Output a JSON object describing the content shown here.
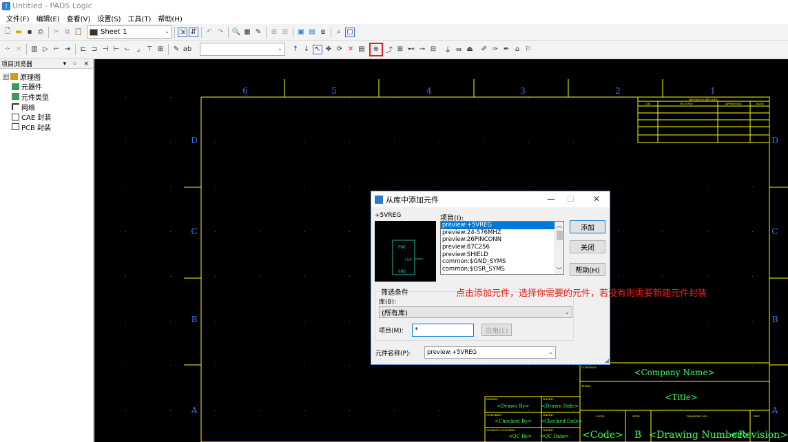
{
  "window": {
    "title": "Untitled - PADS Logic"
  },
  "menu": [
    "文件(F)",
    "编辑(E)",
    "查看(V)",
    "设置(S)",
    "工具(T)",
    "帮助(H)"
  ],
  "toolbar": {
    "sheet_select": "Sheet 1",
    "mode_select": ""
  },
  "browser": {
    "title": "项目浏览器",
    "controls": "▾ ⁘ ×",
    "items": [
      {
        "label": "原理图",
        "expander": "⊞"
      },
      {
        "label": "元器件"
      },
      {
        "label": "元件类型"
      },
      {
        "label": "网络"
      },
      {
        "label": "CAE 封装"
      },
      {
        "label": "PCB 封装"
      }
    ]
  },
  "sheet": {
    "columns": [
      "6",
      "5",
      "4",
      "3",
      "2",
      "1"
    ],
    "rows": [
      "D",
      "C",
      "B",
      "A"
    ],
    "revision_record": {
      "title": "REVISION RECORD",
      "headers": [
        "LTR",
        "ECO NO:",
        "APPROVED:",
        "DATE:"
      ]
    },
    "title_block": {
      "company_label": "COMPANY:",
      "company_value": "<Company Name>",
      "title_label": "TITLE:",
      "title_value": "<Title>",
      "code_label": "CODE:",
      "code_value": "<Code>",
      "size_label": "SIZE:",
      "size_value": "B",
      "drawing_no_label": "DRAWING NO:",
      "drawing_no_value": "<Drawing Number>",
      "rev_label": "REV:",
      "rev_value": "<Revision>",
      "drawn_label": "DRAWN:",
      "drawn_by": "<Drawn By>",
      "drawn_dated_label": "DATED:",
      "drawn_date": "<Drawn Date>",
      "checked_label": "CHECKED:",
      "checked_by": "<Checked By>",
      "checked_dated_label": "DATED:",
      "checked_date": "<Checked Date>",
      "qc_label": "QUALITY CONTROL:",
      "qc_by": "<QC By>",
      "qc_dated_label": "DATED:",
      "qc_date": "<QC Date>"
    }
  },
  "dialog": {
    "title": "从库中添加元件",
    "preview_label": "+5VREG",
    "preview_symbol": {
      "pin_top": "PWR",
      "pin_right": "+5V",
      "pin_bottom": "GND"
    },
    "items_label": "项目(I):",
    "items": [
      "preview:+5VREG",
      "preview:24-576MHZ",
      "preview:26PINCONN",
      "preview:87C256",
      "preview:SHIELD",
      "common:$GND_SYMS",
      "common:$OSR_SYMS"
    ],
    "selected_index": 0,
    "add_button": "添加",
    "close_button": "关闭",
    "help_button": "帮助(H)",
    "filter_label": "筛选条件",
    "library_label": "库(B):",
    "library_value": "(所有库)",
    "item_filter_label": "项目(M):",
    "item_filter_value": "*",
    "apply_button": "应用(L)",
    "part_name_label": "元件名称(P):",
    "part_name_value": "preview:+5VREG"
  },
  "annotation": "点击添加元件，选择你需要的元件，若没有则需要新建元件封装",
  "colors": {
    "canvas": "#000000",
    "border": "#ffff00",
    "text_yellow": "#ffff00",
    "grid_label": "#3a78ff",
    "annotation": "#e8231b",
    "highlight": "#e02020"
  }
}
